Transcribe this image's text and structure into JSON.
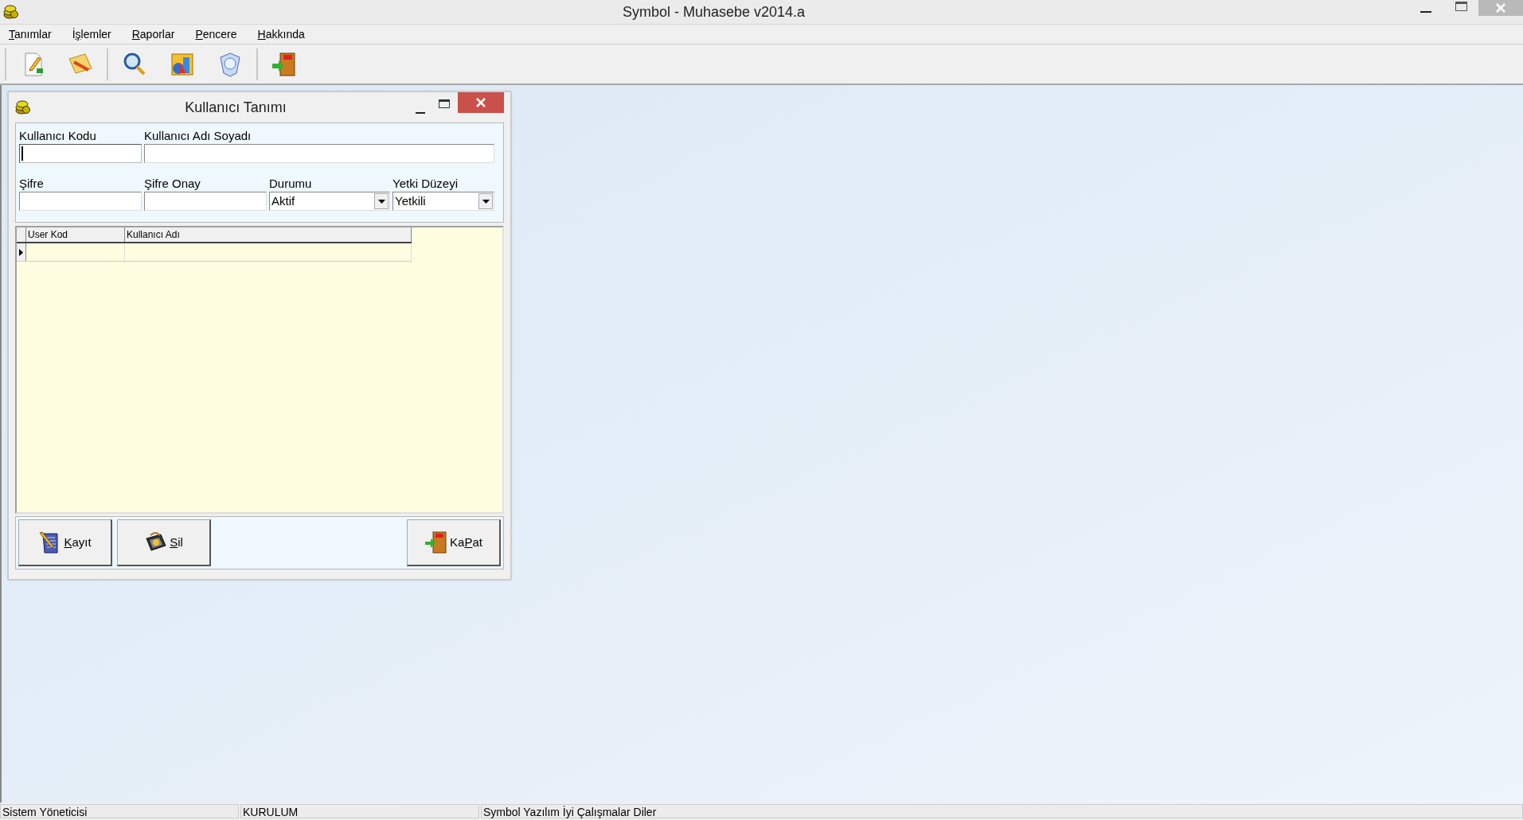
{
  "window": {
    "title": "Symbol - Muhasebe v2014.a"
  },
  "menu": [
    {
      "key": "T",
      "after": "anımlar"
    },
    {
      "before": "İ",
      "key": "ş",
      "after": "lemler"
    },
    {
      "key": "R",
      "after": "aporlar"
    },
    {
      "key": "P",
      "after": "encere"
    },
    {
      "key": "H",
      "after": "akkında"
    }
  ],
  "dialog": {
    "title": "Kullanıcı Tanımı",
    "field_rows": [
      [
        {
          "kind": "text",
          "label": "Kullanıcı Kodu",
          "focused": true
        },
        {
          "kind": "text",
          "label": "Kullanıcı Adı Soyadı",
          "focused": false
        }
      ],
      [
        {
          "kind": "text",
          "label": "Şifre",
          "focused": false
        },
        {
          "kind": "text",
          "label": "Şifre Onay",
          "focused": false
        },
        {
          "kind": "select",
          "label": "Durumu",
          "value": "Aktif"
        },
        {
          "kind": "select",
          "label": "Yetki Düzeyi",
          "value": "Yetkili"
        }
      ]
    ],
    "grid": {
      "columns": [
        "User Kod",
        "Kullanıcı Adı"
      ],
      "rows": [
        {
          "current": true
        }
      ]
    },
    "buttons": [
      {
        "kind": "save",
        "key": "K",
        "after": "ayıt"
      },
      {
        "kind": "delete",
        "key": "S",
        "after": "il"
      },
      {
        "kind": "close",
        "before": "Ka",
        "key": "P",
        "after": "at"
      }
    ]
  },
  "status_bar": [
    "Sistem Yöneticisi",
    "KURULUM",
    "Symbol Yazılım İyi Çalışmalar Diler"
  ]
}
